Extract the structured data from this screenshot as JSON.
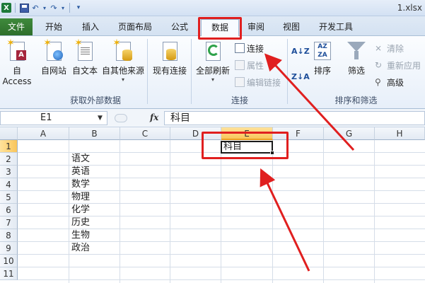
{
  "titlebar": {
    "filename": "1.xlsx",
    "app_logo": "X"
  },
  "tabs": [
    "文件",
    "开始",
    "插入",
    "页面布局",
    "公式",
    "数据",
    "审阅",
    "视图",
    "开发工具"
  ],
  "active_tab": "数据",
  "ribbon": {
    "external_data": {
      "buttons": [
        "自 Access",
        "自网站",
        "自文本",
        "自其他来源"
      ],
      "existing_connections": "现有连接",
      "group_label": "获取外部数据"
    },
    "connections": {
      "refresh_all": "全部刷新",
      "connections": "连接",
      "properties": "属性",
      "edit_links": "编辑链接",
      "group_label": "连接"
    },
    "sort_filter": {
      "sort": "排序",
      "filter": "筛选",
      "clear": "清除",
      "reapply": "重新应用",
      "advanced": "高级",
      "group_label": "排序和筛选"
    }
  },
  "formula_bar": {
    "name_box": "E1",
    "fx": "fx",
    "formula": "科目"
  },
  "grid": {
    "columns": [
      "A",
      "B",
      "C",
      "D",
      "E",
      "F",
      "G",
      "H"
    ],
    "rows": [
      "1",
      "2",
      "3",
      "4",
      "5",
      "6",
      "7",
      "8",
      "9",
      "10",
      "11"
    ],
    "selected_column": "E",
    "selected_row": "1",
    "cells": {
      "E1": "科目",
      "B2": "语文",
      "B3": "英语",
      "B4": "数学",
      "B5": "物理",
      "B6": "化学",
      "B7": "历史",
      "B8": "生物",
      "B9": "政治"
    }
  },
  "colors": {
    "annotation": "#e01f1f",
    "file_tab": "#2d6e2b",
    "selected_header": "#f9c55a"
  },
  "icons": [
    "excel-logo-icon",
    "save-icon",
    "undo-icon",
    "redo-icon",
    "customize-qat-icon",
    "sort-az-icon",
    "sort-za-icon",
    "filter-funnel-icon",
    "clear-filter-icon",
    "reapply-icon",
    "advanced-filter-icon",
    "refresh-icon",
    "connections-icon",
    "properties-icon",
    "edit-links-icon"
  ]
}
